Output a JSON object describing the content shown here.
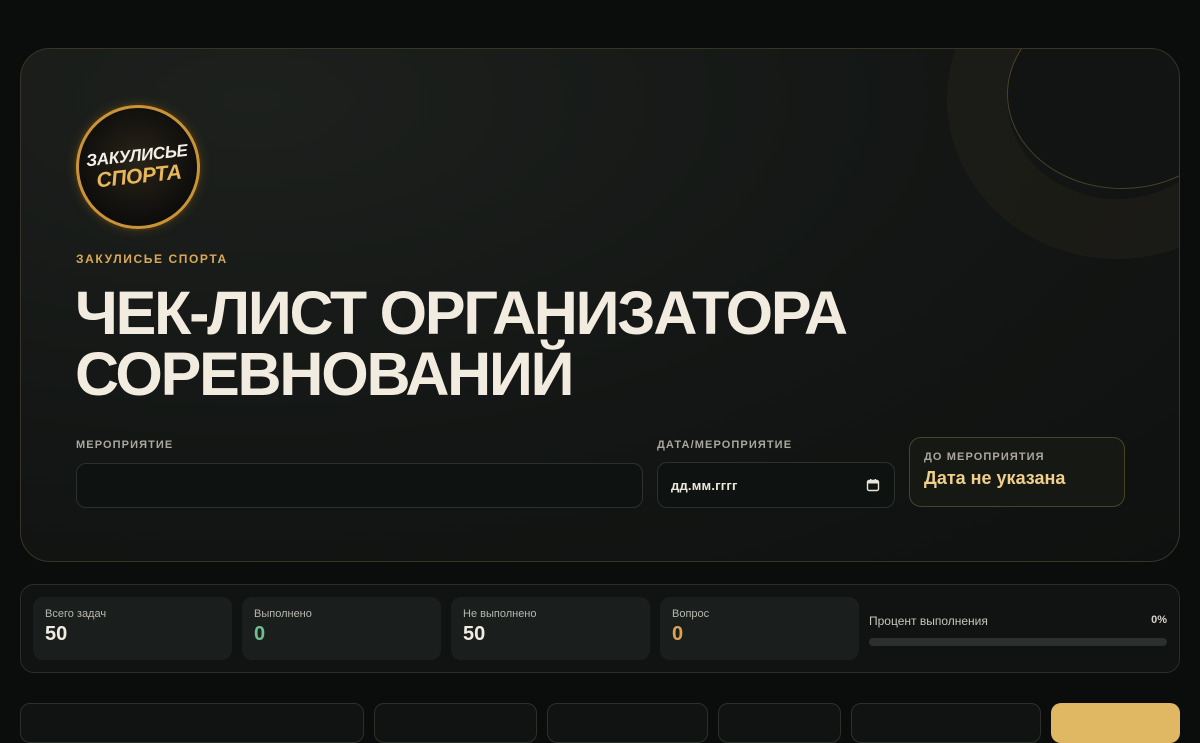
{
  "brand": {
    "logo_line1": "ЗАКУЛИСЬЕ",
    "logo_line2": "СПОРТА",
    "eyebrow": "ЗАКУЛИСЬЕ СПОРТА"
  },
  "header": {
    "title_line1": "ЧЕК-ЛИСТ ОРГАНИЗАТОРА",
    "title_line2": "СОРЕВНОВАНИЙ"
  },
  "form": {
    "event_label": "МЕРОПРИЯТИЕ",
    "event_value": "",
    "date_label": "ДАТА/МЕРОПРИЯТИЕ",
    "date_placeholder": "дд.мм.гггг",
    "until_label": "ДО МЕРОПРИЯТИЯ",
    "until_value": "Дата не указана"
  },
  "stats": {
    "total_label": "Всего задач",
    "total_value": "50",
    "done_label": "Выполнено",
    "done_value": "0",
    "notdone_label": "Не выполнено",
    "notdone_value": "50",
    "question_label": "Вопрос",
    "question_value": "0",
    "progress_label": "Процент выполнения",
    "progress_text": "0%",
    "progress_fraction": 0
  },
  "colors": {
    "accent": "#d9a957",
    "done": "#6fbf8e",
    "question": "#e0a24f",
    "notdone": "#f2ece0"
  }
}
